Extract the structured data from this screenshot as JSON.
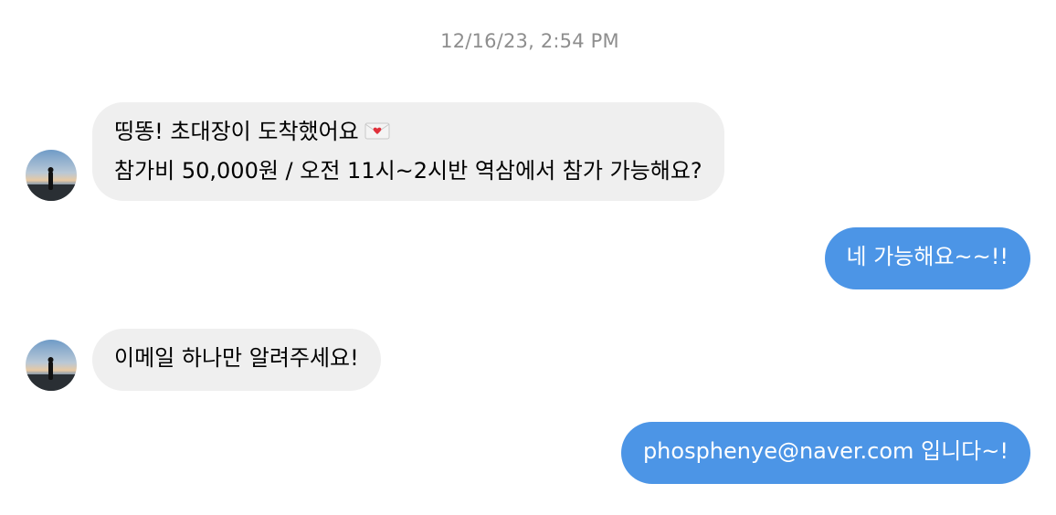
{
  "conversation": {
    "timestamp": "12/16/23, 2:54 PM",
    "messages": [
      {
        "direction": "incoming",
        "lines": [
          "띵똥! 초대장이 도착했어요",
          "참가비 50,000원 / 오전 11시~2시반 역삼에서 참가 가능해요?"
        ],
        "emoji": "love-letter-icon"
      },
      {
        "direction": "outgoing",
        "lines": [
          "네 가능해요~~!!"
        ]
      },
      {
        "direction": "incoming",
        "lines": [
          "이메일 하나만 알려주세요!"
        ]
      },
      {
        "direction": "outgoing",
        "lines": [
          "phosphenye@naver.com 입니다~!"
        ]
      }
    ]
  },
  "colors": {
    "incoming_bubble": "#efefef",
    "outgoing_bubble": "#4c95e6",
    "timestamp": "#8e8e8e"
  }
}
